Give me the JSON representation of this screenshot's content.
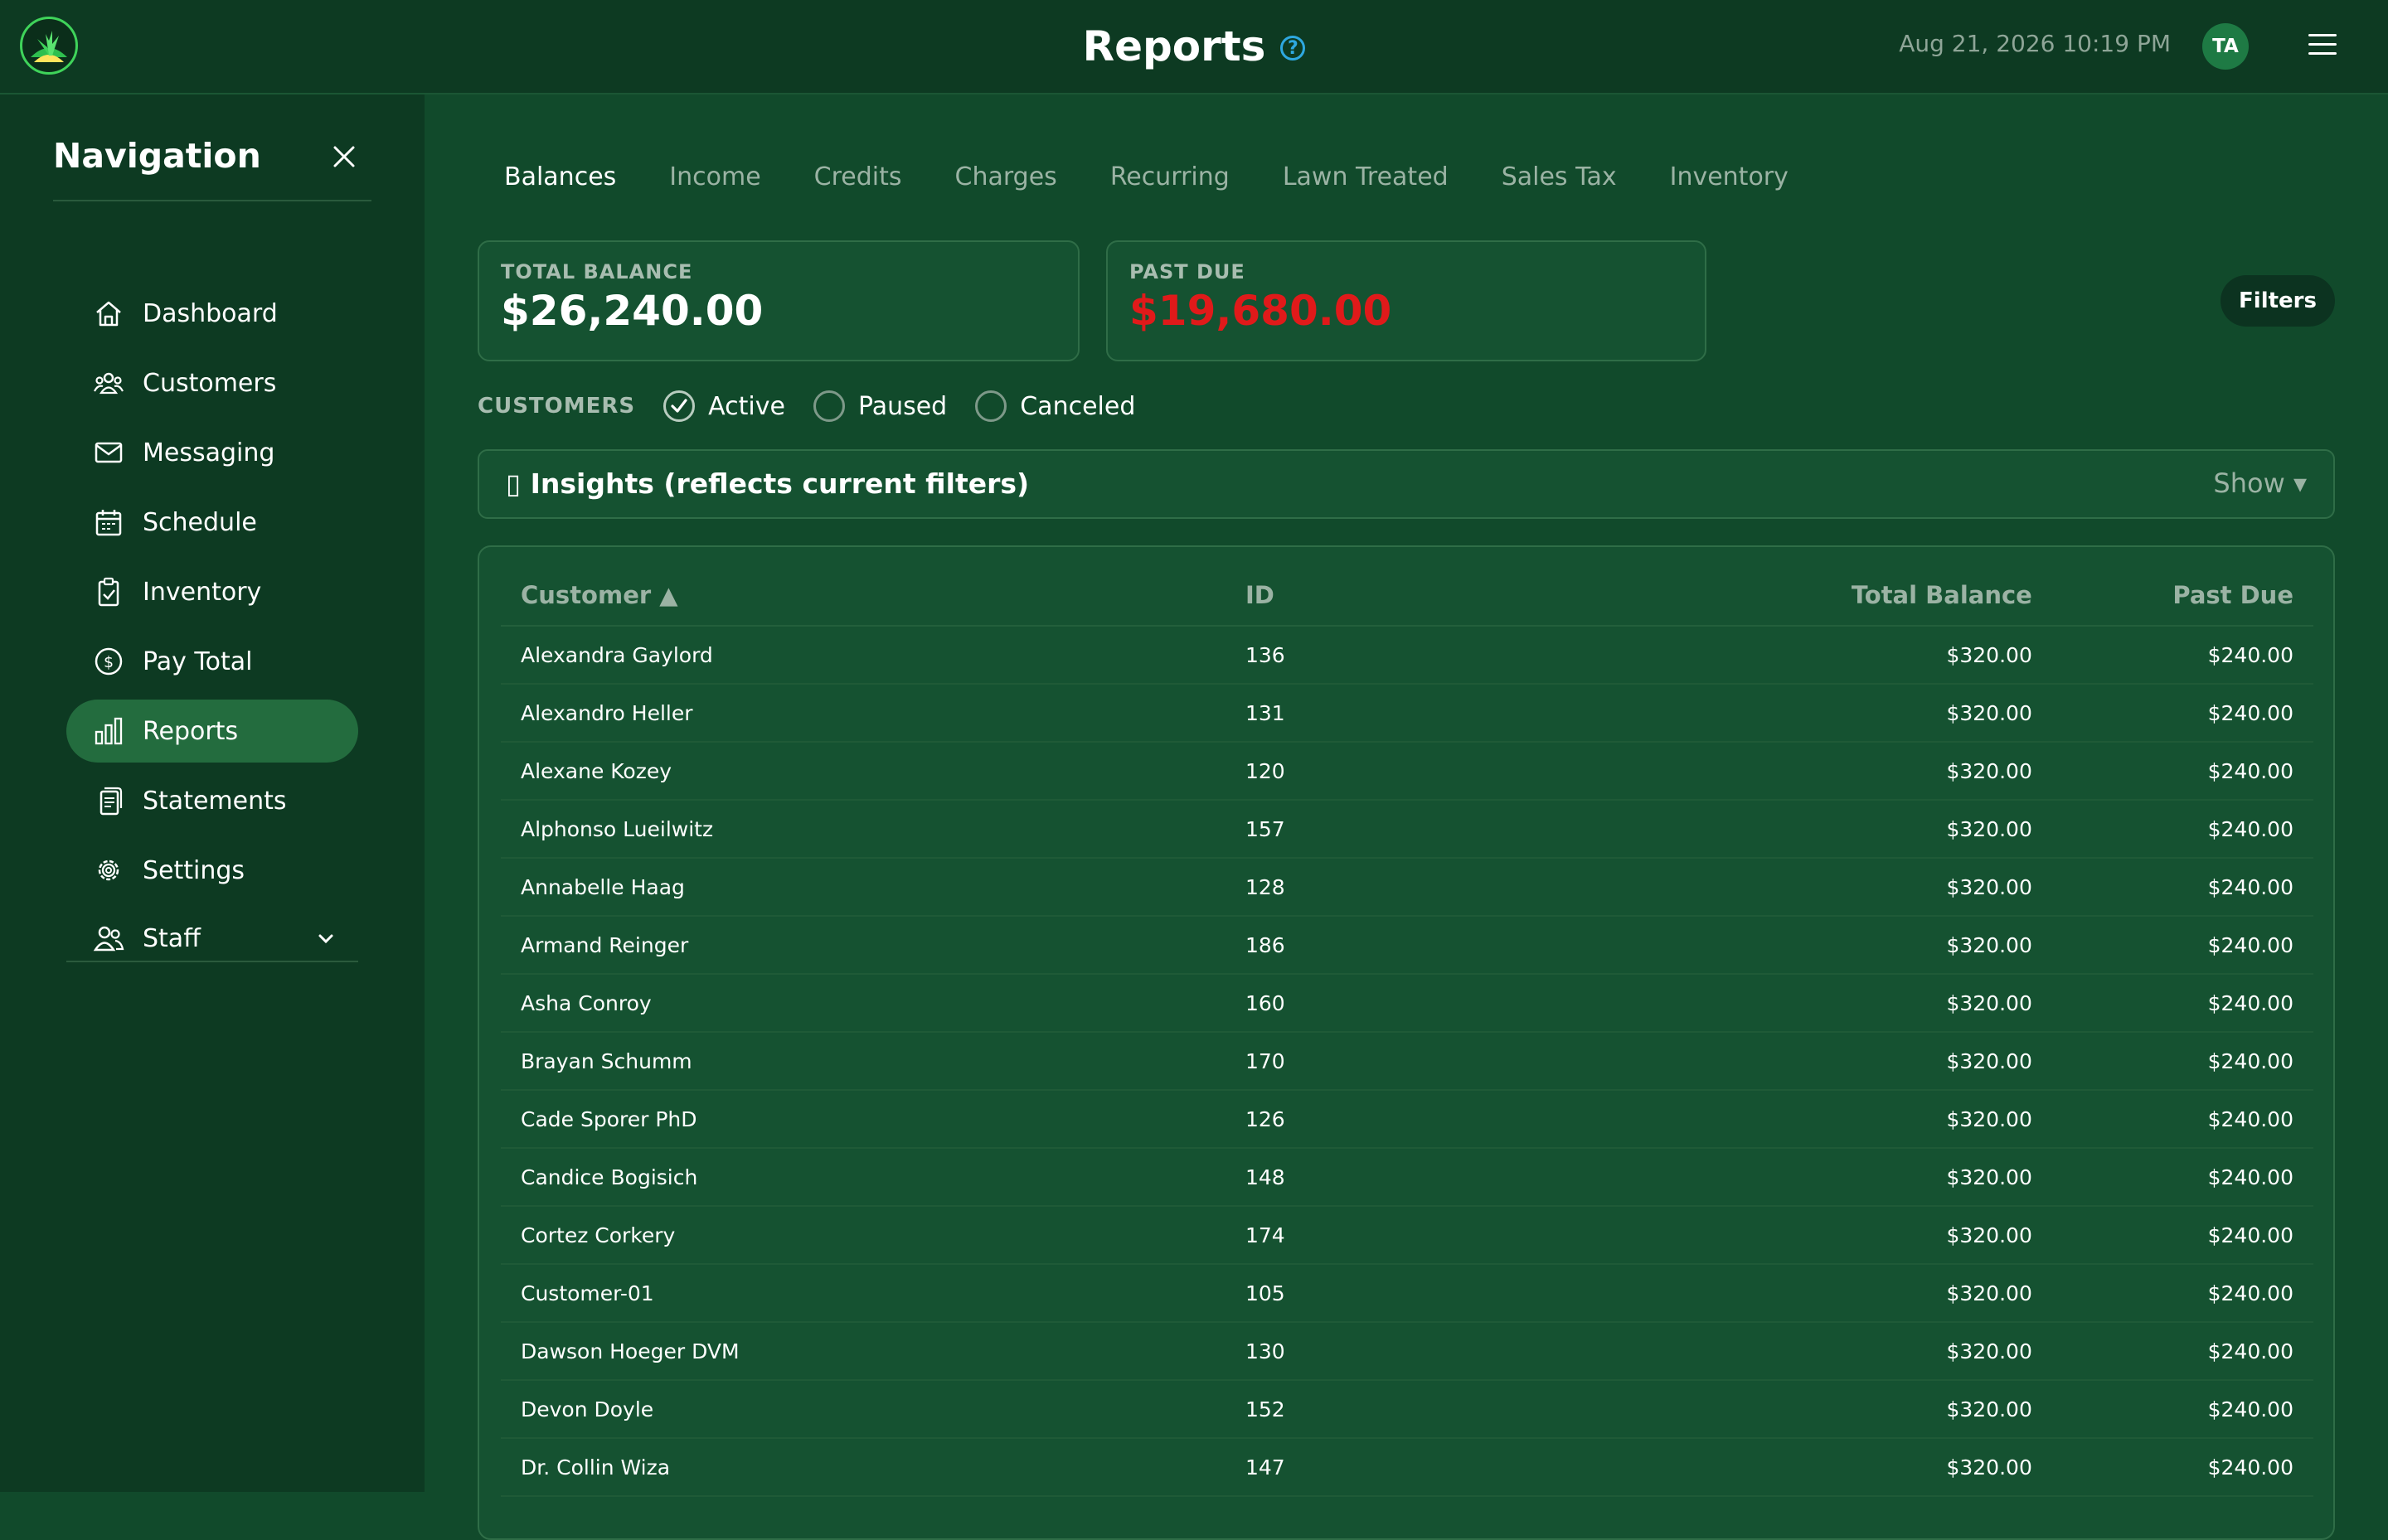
{
  "header": {
    "title": "Reports",
    "help_icon": "?",
    "datetime": "Aug 21, 2026 10:19 PM",
    "avatar_initials": "TA"
  },
  "sidebar": {
    "title": "Navigation",
    "items": [
      {
        "label": "Dashboard",
        "icon": "home-icon"
      },
      {
        "label": "Customers",
        "icon": "users-icon"
      },
      {
        "label": "Messaging",
        "icon": "mail-icon"
      },
      {
        "label": "Schedule",
        "icon": "calendar-icon"
      },
      {
        "label": "Inventory",
        "icon": "clipboard-check-icon"
      },
      {
        "label": "Pay Total",
        "icon": "dollar-circle-icon"
      },
      {
        "label": "Reports",
        "icon": "bar-chart-icon",
        "active": true
      },
      {
        "label": "Statements",
        "icon": "documents-icon"
      },
      {
        "label": "Settings",
        "icon": "gear-icon"
      },
      {
        "label": "Staff",
        "icon": "staff-icon",
        "expandable": true
      }
    ]
  },
  "tabs": [
    {
      "label": "Balances",
      "active": true
    },
    {
      "label": "Income"
    },
    {
      "label": "Credits"
    },
    {
      "label": "Charges"
    },
    {
      "label": "Recurring"
    },
    {
      "label": "Lawn Treated"
    },
    {
      "label": "Sales Tax"
    },
    {
      "label": "Inventory"
    }
  ],
  "stats": {
    "total_balance": {
      "label": "TOTAL BALANCE",
      "value": "$26,240.00"
    },
    "past_due": {
      "label": "PAST DUE",
      "value": "$19,680.00",
      "color": "#e01a1a"
    }
  },
  "filters_button": "Filters",
  "customers_filter": {
    "label": "CUSTOMERS",
    "options": [
      {
        "label": "Active",
        "checked": true
      },
      {
        "label": "Paused",
        "checked": false
      },
      {
        "label": "Canceled",
        "checked": false
      }
    ]
  },
  "insights": {
    "title": "▯ Insights (reflects current filters)",
    "toggle": "Show ▾"
  },
  "table": {
    "headers": [
      "Customer ▲",
      "ID",
      "Total Balance",
      "Past Due"
    ],
    "rows": [
      [
        "Alexandra Gaylord",
        "136",
        "$320.00",
        "$240.00"
      ],
      [
        "Alexandro Heller",
        "131",
        "$320.00",
        "$240.00"
      ],
      [
        "Alexane Kozey",
        "120",
        "$320.00",
        "$240.00"
      ],
      [
        "Alphonso Lueilwitz",
        "157",
        "$320.00",
        "$240.00"
      ],
      [
        "Annabelle Haag",
        "128",
        "$320.00",
        "$240.00"
      ],
      [
        "Armand Reinger",
        "186",
        "$320.00",
        "$240.00"
      ],
      [
        "Asha Conroy",
        "160",
        "$320.00",
        "$240.00"
      ],
      [
        "Brayan Schumm",
        "170",
        "$320.00",
        "$240.00"
      ],
      [
        "Cade Sporer PhD",
        "126",
        "$320.00",
        "$240.00"
      ],
      [
        "Candice Bogisich",
        "148",
        "$320.00",
        "$240.00"
      ],
      [
        "Cortez Corkery",
        "174",
        "$320.00",
        "$240.00"
      ],
      [
        "Customer-01",
        "105",
        "$320.00",
        "$240.00"
      ],
      [
        "Dawson Hoeger DVM",
        "130",
        "$320.00",
        "$240.00"
      ],
      [
        "Devon Doyle",
        "152",
        "$320.00",
        "$240.00"
      ],
      [
        "Dr. Collin Wiza",
        "147",
        "$320.00",
        "$240.00"
      ]
    ]
  }
}
